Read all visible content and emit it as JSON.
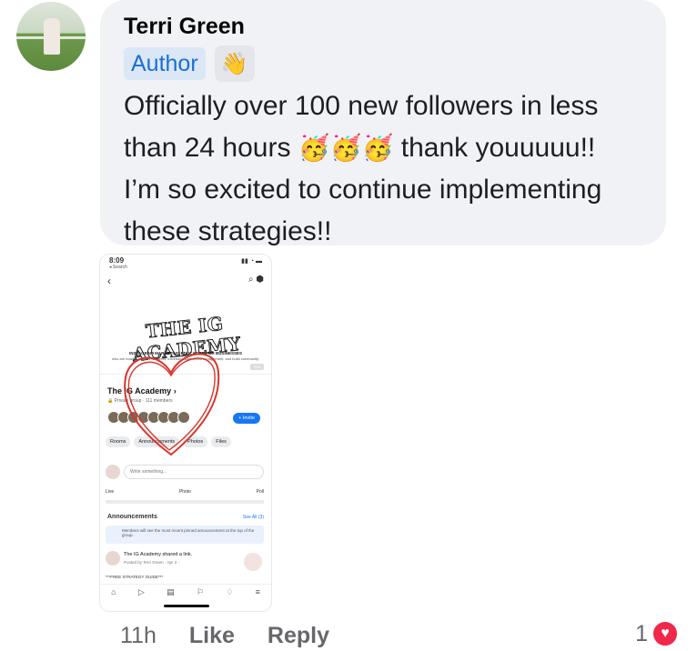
{
  "comment": {
    "author_name": "Terri Green",
    "author_badge": "Author",
    "wave_icon": "👋",
    "text_line1": "Officially over 100 new followers in less",
    "text_line2_a": "than 24 hours",
    "text_emojis": "🥳🥳🥳",
    "text_line2_b": "thank youuuuu!!",
    "text_line3": "I’m so excited to continue implementing",
    "text_line4": "these strategies!!"
  },
  "attachment": {
    "status_time": "8:09",
    "status_back": "◂ Search",
    "banner_title": "THE IG ACADEMY",
    "banner_sub1": "INSTAGRAM MARKETING EDUCATION FOR BUSINESSES",
    "banner_sub2": "who are looking to grow followers, increase sales, boost engagement, and build community.",
    "banner_edit": "Edit",
    "group_name": "The IG Academy ›",
    "group_meta": "🔒 Private group · 111 members",
    "invite_label": "+ Invite",
    "pills": [
      "Rooms",
      "Announcements",
      "Photos",
      "Files"
    ],
    "write_placeholder": "Write something...",
    "actions": [
      "Live",
      "Photo",
      "Poll"
    ],
    "announcements_title": "Announcements",
    "see_all": "See All (3)",
    "announce_note": "Members will see the most recent pinned announcement at the top of the group.",
    "post_author": "The IG Academy shared a link.",
    "post_meta": "Posted by Terri Green · Apr 2 ·",
    "post_preview": "***FREE STRATEGY GUIDE***"
  },
  "footer": {
    "time": "11h",
    "like": "Like",
    "reply": "Reply",
    "reaction_count": "1"
  },
  "colors": {
    "bubble": "#f0f2f5",
    "badge_bg": "#dbe7f7",
    "badge_text": "#1a6ed8",
    "heart": "#f0284a",
    "link": "#1877f2"
  }
}
